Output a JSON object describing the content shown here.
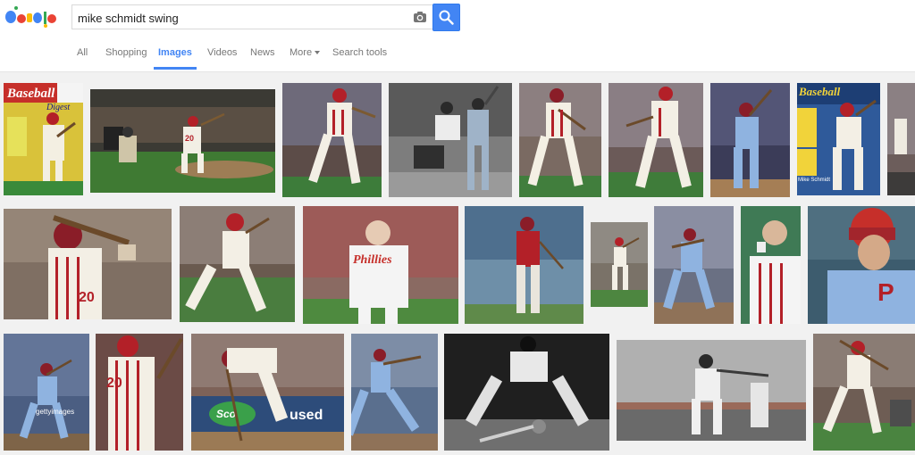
{
  "search": {
    "query": "mike schmidt swing"
  },
  "tabs": [
    {
      "label": "All"
    },
    {
      "label": "Shopping"
    },
    {
      "label": "Images"
    },
    {
      "label": "Videos"
    },
    {
      "label": "News"
    },
    {
      "label": "More"
    },
    {
      "label": "Search tools"
    }
  ],
  "icons": {
    "logo": "google-doodle-logo",
    "camera": "camera-icon",
    "search": "search-icon",
    "more_caret": "caret-down-icon"
  },
  "colors": {
    "accent": "#4285f4",
    "tab_text": "#777777",
    "page_bg": "#f1f1f1"
  },
  "thumbnails": {
    "magazine_title": "Baseball",
    "magazine_subtitle": "Digest",
    "jersey_text": "Phillies",
    "jersey_number": "20",
    "sign_text": "used",
    "sign_brand": "Sco",
    "watermark": "gettyimages",
    "magazine_name_text": "Mike Schmidt"
  }
}
